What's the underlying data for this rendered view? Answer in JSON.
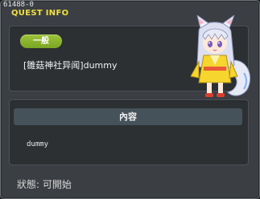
{
  "window": {
    "quest_id": "61488-0",
    "title": "QUEST INFO"
  },
  "quest": {
    "category_badge": "一般",
    "name": "[雛菇神社异闻]dummy"
  },
  "content": {
    "header": "內容",
    "text": "dummy"
  },
  "status": {
    "text": "狀態: 可開始"
  },
  "colors": {
    "title": "#f0e040",
    "badge": "#8cb830",
    "panel": "#2c3033",
    "window": "#3b3f43",
    "header_bar": "#46525a"
  },
  "icons": [
    "npc-fox-girl-portrait"
  ]
}
